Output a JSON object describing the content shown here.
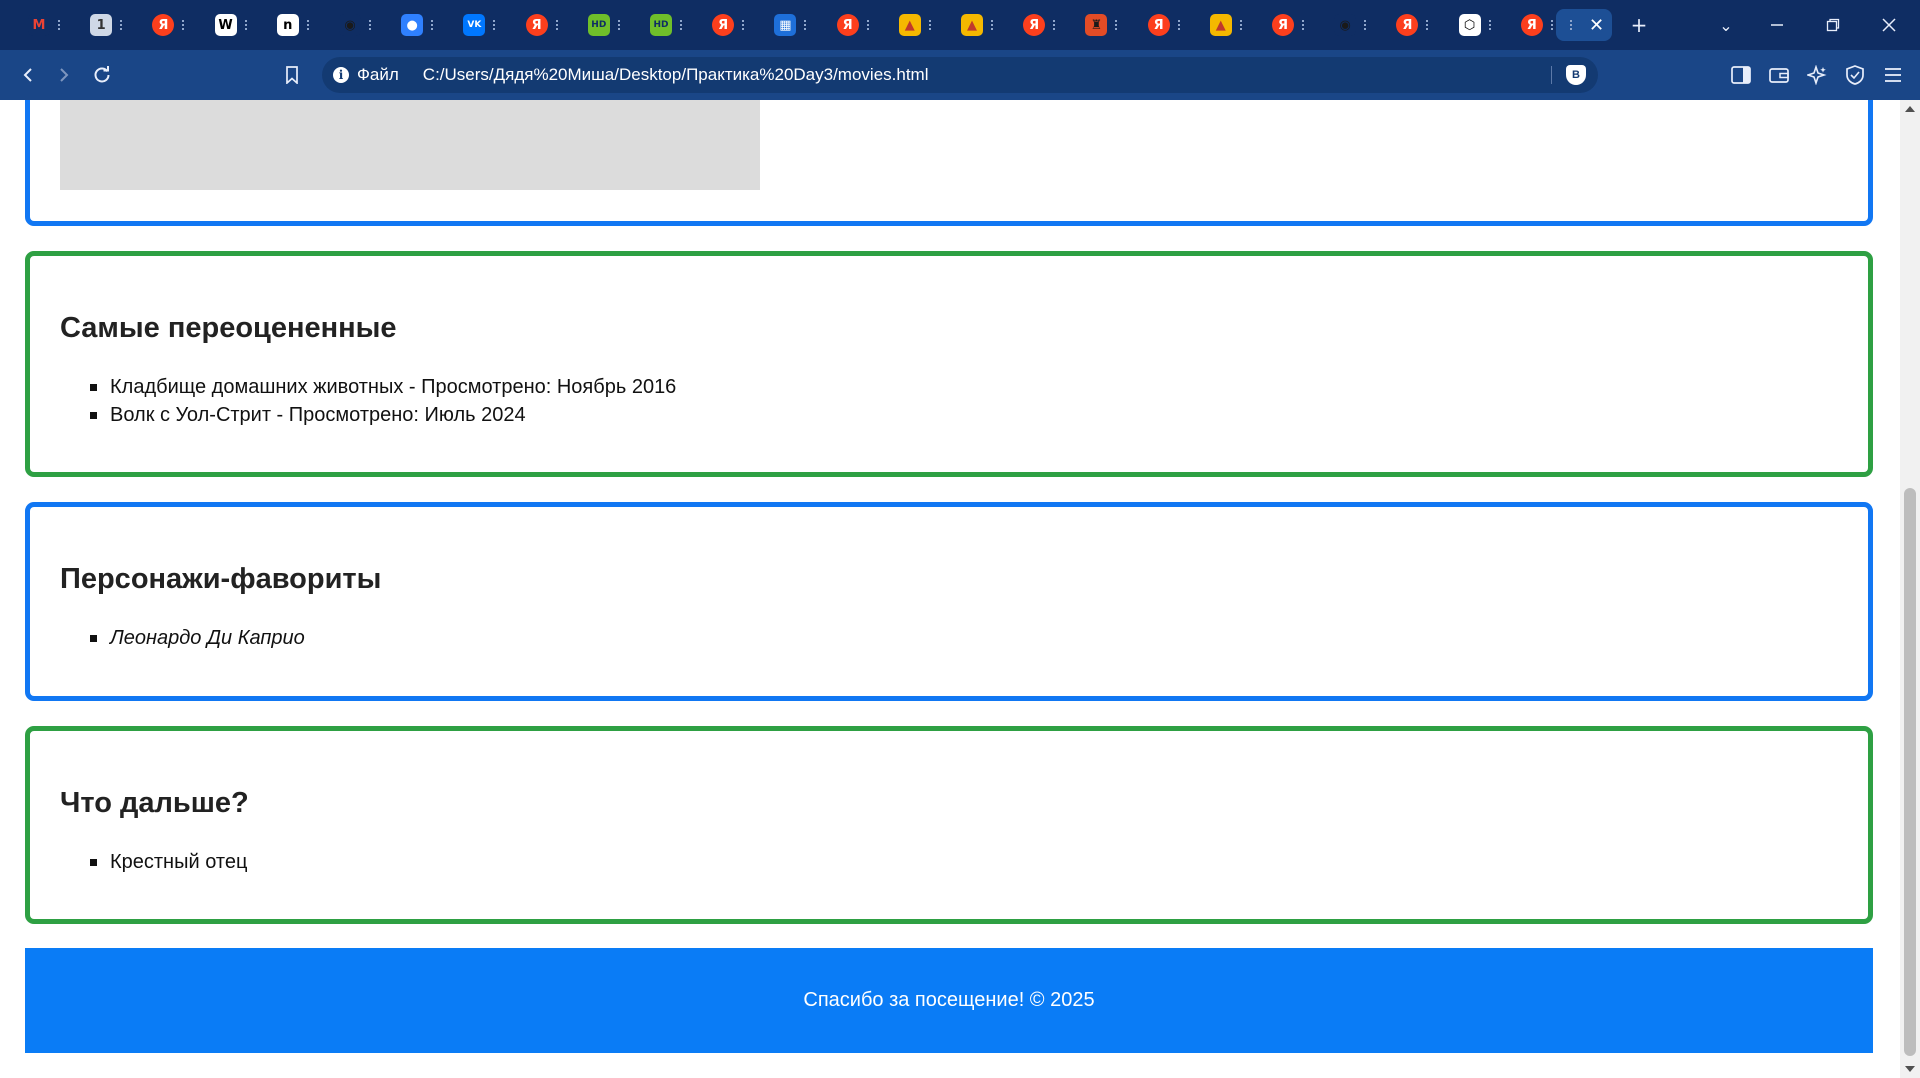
{
  "browser": {
    "tabs": [
      {
        "icon": "gmail-icon",
        "letter": "M",
        "bg": "#0f2d63",
        "fg": "#ea4335"
      },
      {
        "icon": "calendar-icon",
        "letter": "1",
        "bg": "#cfd8e6",
        "fg": "#333333"
      },
      {
        "icon": "yandex-icon",
        "letter": "Я",
        "bg": "#fc3f1d",
        "fg": "#ffffff"
      },
      {
        "icon": "wikipedia-icon",
        "letter": "W",
        "bg": "#ffffff",
        "fg": "#000000"
      },
      {
        "icon": "notion-icon",
        "letter": "n",
        "bg": "#ffffff",
        "fg": "#000000"
      },
      {
        "icon": "github-icon",
        "letter": "◉",
        "bg": "#0f2d63",
        "fg": "#1a1a1a"
      },
      {
        "icon": "chat-icon",
        "letter": "●",
        "bg": "#2f80ff",
        "fg": "#ffffff"
      },
      {
        "icon": "vk-icon",
        "letter": "VK",
        "bg": "#0077ff",
        "fg": "#ffffff"
      },
      {
        "icon": "yandex-icon",
        "letter": "Я",
        "bg": "#fc3f1d",
        "fg": "#ffffff"
      },
      {
        "icon": "hd-icon",
        "letter": "HD",
        "bg": "#6fbf2a",
        "fg": "#0f2d63"
      },
      {
        "icon": "hd-icon",
        "letter": "HD",
        "bg": "#6fbf2a",
        "fg": "#0f2d63"
      },
      {
        "icon": "yandex-icon",
        "letter": "Я",
        "bg": "#fc3f1d",
        "fg": "#ffffff"
      },
      {
        "icon": "grid-icon",
        "letter": "▦",
        "bg": "#1e6fd9",
        "fg": "#ffffff"
      },
      {
        "icon": "yandex-icon",
        "letter": "Я",
        "bg": "#fc3f1d",
        "fg": "#ffffff"
      },
      {
        "icon": "image-icon",
        "letter": "▲",
        "bg": "#f5b800",
        "fg": "#c0392b"
      },
      {
        "icon": "image-icon",
        "letter": "▲",
        "bg": "#f5b800",
        "fg": "#c0392b"
      },
      {
        "icon": "yandex-icon",
        "letter": "Я",
        "bg": "#fc3f1d",
        "fg": "#ffffff"
      },
      {
        "icon": "castle-icon",
        "letter": "♜",
        "bg": "#e34c26",
        "fg": "#1a1a1a"
      },
      {
        "icon": "yandex-icon",
        "letter": "Я",
        "bg": "#fc3f1d",
        "fg": "#ffffff"
      },
      {
        "icon": "image-icon",
        "letter": "▲",
        "bg": "#f5b800",
        "fg": "#c0392b"
      },
      {
        "icon": "yandex-icon",
        "letter": "Я",
        "bg": "#fc3f1d",
        "fg": "#ffffff"
      },
      {
        "icon": "github-icon",
        "letter": "◉",
        "bg": "#0f2d63",
        "fg": "#1a1a1a"
      },
      {
        "icon": "yandex-icon",
        "letter": "Я",
        "bg": "#fc3f1d",
        "fg": "#ffffff"
      },
      {
        "icon": "codepen-icon",
        "letter": "⬡",
        "bg": "#ffffff",
        "fg": "#000000"
      },
      {
        "icon": "yandex-icon",
        "letter": "Я",
        "bg": "#fc3f1d",
        "fg": "#ffffff"
      }
    ],
    "new_tab_label": "+",
    "protocol_label": "Файл",
    "url": "C:/Users/Дядя%20Миша/Desktop/Практика%20Day3/movies.html",
    "shield_label": "B",
    "colors": {
      "tabstrip": "#0f2d63",
      "toolbar": "#1a4687",
      "omnibox": "#133a72",
      "active_tab": "#1d4f95"
    }
  },
  "page": {
    "sections": [
      {
        "title": "Самые переоцененные",
        "color": "#2ea043",
        "items": [
          "Кладбище домашних животных - Просмотрено: Ноябрь 2016",
          "Волк с Уол-Стрит - Просмотрено: Июль 2024"
        ]
      },
      {
        "title": "Персонажи-фавориты",
        "color": "#1177f3",
        "items": [
          "Леонардо Ди Каприо"
        ]
      },
      {
        "title": "Что дальше?",
        "color": "#2ea043",
        "items": [
          "Крестный отец"
        ]
      }
    ],
    "footer": "Спасибо за посещение! © 2025",
    "colors": {
      "blue_border": "#1177f3",
      "green_border": "#2ea043",
      "footer_bg": "#0a7cf6",
      "image_placeholder": "#dcdcdc"
    }
  }
}
